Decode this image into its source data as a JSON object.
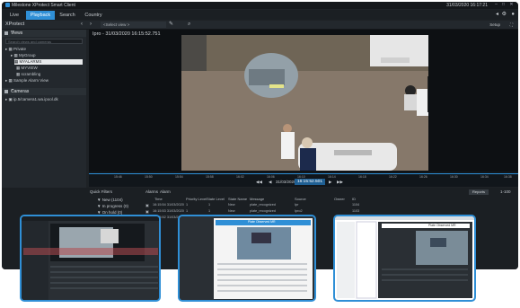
{
  "window": {
    "title": "Milestone XProtect Smart Client",
    "clock": "31/03/2020 16:17:21"
  },
  "tabs": [
    {
      "label": "Live"
    },
    {
      "label": "Playback"
    },
    {
      "label": "Search"
    },
    {
      "label": "Country"
    }
  ],
  "view_bar": {
    "label": "XProtect",
    "select_placeholder": "<Select view >",
    "setup_label": "Setup"
  },
  "sidebar": {
    "views_header": "Views",
    "search_placeholder": "Search views and cameras",
    "tree": [
      {
        "label": "Private",
        "level": 0
      },
      {
        "label": "MyGroup",
        "level": 1
      },
      {
        "label": "MYALARMS",
        "level": 2,
        "selected": true
      },
      {
        "label": "MYVIEW",
        "level": 2
      },
      {
        "label": "scrambling",
        "level": 2
      },
      {
        "label": "Sample Alarm View",
        "level": 0
      }
    ],
    "cameras_header": "Cameras",
    "camera_item": "ip.5/camera1.wa.ipool.dk"
  },
  "player": {
    "camera_title": "Ipro - 31/03/2020 16:15:52.751",
    "current_time": "16:15:52.501",
    "date_label": "31/03/2020",
    "ticks": [
      "15:46",
      "15:50",
      "15:54",
      "15:58",
      "16:02",
      "16:06",
      "16:10",
      "16:14",
      "16:18",
      "16:22",
      "16:26",
      "16:30",
      "16:34",
      "16:38"
    ]
  },
  "quick_filters": {
    "title": "Quick Filters",
    "items": [
      {
        "label": "New (1104)"
      },
      {
        "label": "In progress (0)"
      },
      {
        "label": "On hold (0)"
      }
    ]
  },
  "alarms": {
    "title": "Alarms",
    "filter": "Alarm",
    "columns": [
      "Time",
      "Priority Level",
      "State Level",
      "State Name",
      "Message",
      "Source",
      "Owner",
      "ID"
    ],
    "rows": [
      [
        "16:15:54 31/03/2020",
        "1",
        "1",
        "New",
        "plate_recognized",
        "Ipr",
        "",
        "1104"
      ],
      [
        "16:15:53 31/03/2020",
        "1",
        "1",
        "New",
        "plate_recognized",
        "Ipro2",
        "",
        "1103"
      ],
      [
        "16:15:52 31/03/2020",
        "1",
        "1",
        "New",
        "plate_recognized",
        "Ipr",
        "",
        "1102"
      ]
    ],
    "report_label": "Reports",
    "count_label": "1-100"
  },
  "screens": {
    "second_title": "Plate Observed MR",
    "third_title": "Plate Observed MR"
  },
  "colors": {
    "accent": "#2f8fd6",
    "dark_bg": "#1e2226",
    "selected_row": "#e8eaec"
  },
  "icons": {
    "live_icon": "camera-icon",
    "tag_icon": "tag-icon",
    "settings_icon": "gear-icon"
  }
}
